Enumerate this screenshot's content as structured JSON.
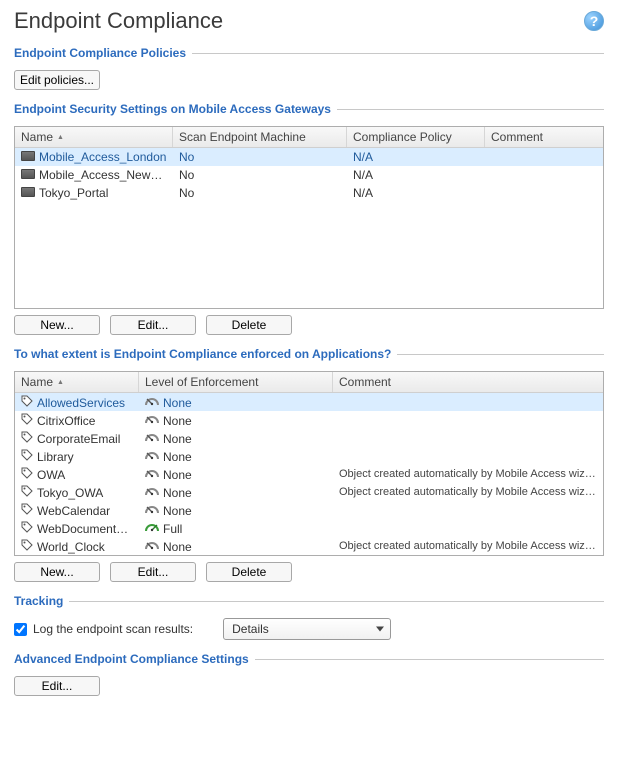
{
  "page": {
    "title": "Endpoint Compliance"
  },
  "policies": {
    "header": "Endpoint Compliance Policies",
    "edit_btn": "Edit policies..."
  },
  "gateways": {
    "header": "Endpoint Security Settings on Mobile Access Gateways",
    "new_btn": "New...",
    "edit_btn": "Edit...",
    "delete_btn": "Delete",
    "columns": {
      "name": "Name",
      "scan": "Scan Endpoint Machine",
      "compliance": "Compliance Policy",
      "comment": "Comment"
    },
    "rows": [
      {
        "name": "Mobile_Access_London",
        "scan": "No",
        "compliance": "N/A",
        "comment": "",
        "selected": true
      },
      {
        "name": "Mobile_Access_NewYork",
        "scan": "No",
        "compliance": "N/A",
        "comment": "",
        "selected": false
      },
      {
        "name": "Tokyo_Portal",
        "scan": "No",
        "compliance": "N/A",
        "comment": "",
        "selected": false
      }
    ]
  },
  "apps": {
    "header": "To what extent is Endpoint Compliance enforced on Applications?",
    "new_btn": "New...",
    "edit_btn": "Edit...",
    "delete_btn": "Delete",
    "columns": {
      "name": "Name",
      "level": "Level of Enforcement",
      "comment": "Comment"
    },
    "rows": [
      {
        "name": "AllowedServices",
        "level": "None",
        "comment": "",
        "selected": true
      },
      {
        "name": "CitrixOffice",
        "level": "None",
        "comment": "",
        "selected": false
      },
      {
        "name": "CorporateEmail",
        "level": "None",
        "comment": "",
        "selected": false
      },
      {
        "name": "Library",
        "level": "None",
        "comment": "",
        "selected": false
      },
      {
        "name": "OWA",
        "level": "None",
        "comment": "Object created automatically by Mobile Access wizard.",
        "selected": false
      },
      {
        "name": "Tokyo_OWA",
        "level": "None",
        "comment": "Object created automatically by Mobile Access wizard.",
        "selected": false
      },
      {
        "name": "WebCalendar",
        "level": "None",
        "comment": "",
        "selected": false
      },
      {
        "name": "WebDocumentation",
        "level": "Full",
        "comment": "",
        "selected": false
      },
      {
        "name": "World_Clock",
        "level": "None",
        "comment": "Object created automatically by Mobile Access wizard.",
        "selected": false
      }
    ]
  },
  "tracking": {
    "header": "Tracking",
    "checkbox_label": "Log the endpoint scan results:",
    "checked": true,
    "select_value": "Details"
  },
  "advanced": {
    "header": "Advanced Endpoint Compliance Settings",
    "edit_btn": "Edit..."
  }
}
